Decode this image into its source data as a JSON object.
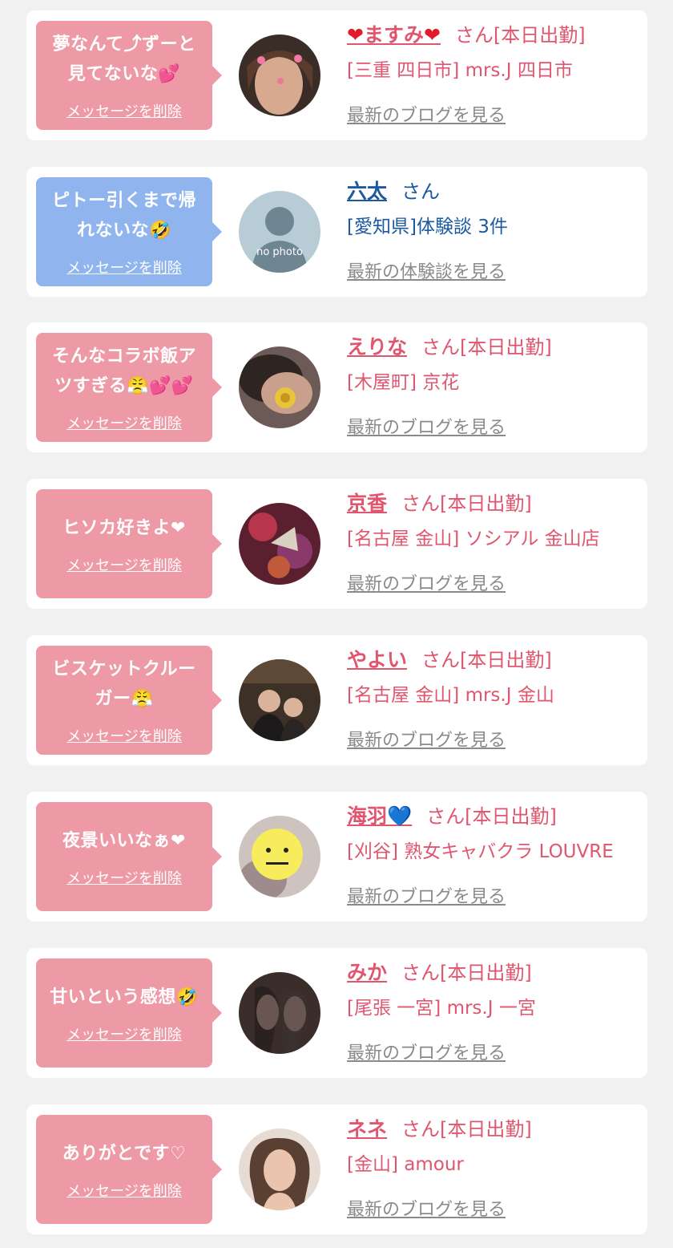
{
  "delete_label": "メッセージを削除",
  "colors": {
    "pink_bubble": "#ee9aa6",
    "blue_bubble": "#90b5ee",
    "pink_text": "#e0566e",
    "blue_text": "#1c5aa0",
    "link_gray": "#8a8a8a"
  },
  "cards": [
    {
      "msg_l1": "夢なんて⤴ずーと",
      "msg_l2": "見てないな💕",
      "name_pre": "❤",
      "name": "ますみ",
      "name_post": "❤",
      "suffix": "さん[本日出勤]",
      "detail": "[三重 四日市] mrs.J 四日市",
      "link": "最新のブログを見る",
      "avatar_icon": "woman-photo-icon"
    },
    {
      "msg_l1": "ピトー引くまで帰",
      "msg_l2": "れないな🤣",
      "name_pre": "",
      "name": "六太",
      "name_post": "",
      "suffix": "さん",
      "detail": "[愛知県]体験談 3件",
      "link": "最新の体験談を見る",
      "avatar_icon": "no-photo-placeholder-icon",
      "avatar_text": "no photo"
    },
    {
      "msg_l1": "そんなコラボ飯ア",
      "msg_l2": "ツすぎる😤💕💕",
      "name_pre": "",
      "name": "えりな",
      "name_post": "",
      "suffix": "さん[本日出勤]",
      "detail": "[木屋町] 京花",
      "link": "最新のブログを見る",
      "avatar_icon": "rose-photo-icon"
    },
    {
      "msg_l1": "ヒソカ好きよ❤",
      "msg_l2": "",
      "name_pre": "",
      "name": "京香",
      "name_post": "",
      "suffix": "さん[本日出勤]",
      "detail": "[名古屋 金山] ソシアル 金山店",
      "link": "最新のブログを見る",
      "avatar_icon": "kimono-photo-icon"
    },
    {
      "msg_l1": "ビスケットクルー",
      "msg_l2": "ガー😤",
      "name_pre": "",
      "name": "やよい",
      "name_post": "",
      "suffix": "さん[本日出勤]",
      "detail": "[名古屋 金山] mrs.J 金山",
      "link": "最新のブログを見る",
      "avatar_icon": "two-women-photo-icon"
    },
    {
      "msg_l1": "夜景いいなぁ❤",
      "msg_l2": "",
      "name_pre": "",
      "name": "海羽",
      "name_post": "💙",
      "suffix": "さん[本日出勤]",
      "detail": "[刈谷] 熟女キャバクラ LOUVRE",
      "link": "最新のブログを見る",
      "avatar_icon": "emoji-face-photo-icon"
    },
    {
      "msg_l1": "甘いという感想🤣",
      "msg_l2": "",
      "name_pre": "",
      "name": "みか",
      "name_post": "",
      "suffix": "さん[本日出勤]",
      "detail": "[尾張 一宮] mrs.J 一宮",
      "link": "最新のブログを見る",
      "avatar_icon": "legs-photo-icon"
    },
    {
      "msg_l1": "ありがとです♡",
      "msg_l2": "",
      "name_pre": "",
      "name": "ネネ",
      "name_post": "",
      "suffix": "さん[本日出勤]",
      "detail": "[金山] amour",
      "link": "最新のブログを見る",
      "avatar_icon": "portrait-photo-icon"
    }
  ]
}
